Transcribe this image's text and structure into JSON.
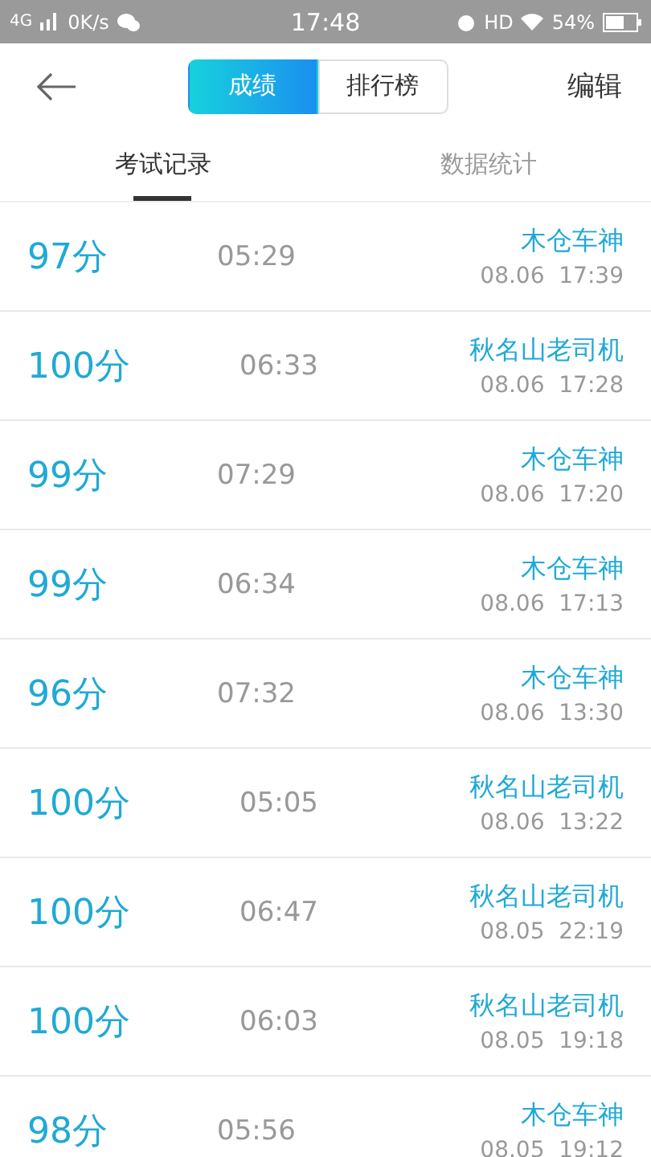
{
  "status_bar": {
    "network": "4G",
    "speed": "0K/s",
    "time": "17:48",
    "hd": "HD",
    "battery": "54%"
  },
  "header": {
    "segments": [
      {
        "label": "成绩",
        "selected": true
      },
      {
        "label": "排行榜",
        "selected": false
      }
    ],
    "action": "编辑"
  },
  "tabs": [
    {
      "label": "考试记录",
      "selected": true
    },
    {
      "label": "数据统计",
      "selected": false
    }
  ],
  "records": [
    {
      "score": "97分",
      "duration": "05:29",
      "name": "木仓车神",
      "date": "08.06  17:39"
    },
    {
      "score": "100分",
      "duration": "06:33",
      "name": "秋名山老司机",
      "date": "08.06  17:28"
    },
    {
      "score": "99分",
      "duration": "07:29",
      "name": "木仓车神",
      "date": "08.06  17:20"
    },
    {
      "score": "99分",
      "duration": "06:34",
      "name": "木仓车神",
      "date": "08.06  17:13"
    },
    {
      "score": "96分",
      "duration": "07:32",
      "name": "木仓车神",
      "date": "08.06  13:30"
    },
    {
      "score": "100分",
      "duration": "05:05",
      "name": "秋名山老司机",
      "date": "08.06  13:22"
    },
    {
      "score": "100分",
      "duration": "06:47",
      "name": "秋名山老司机",
      "date": "08.05  22:19"
    },
    {
      "score": "100分",
      "duration": "06:03",
      "name": "秋名山老司机",
      "date": "08.05  19:18"
    },
    {
      "score": "98分",
      "duration": "05:56",
      "name": "木仓车神",
      "date": "08.05  19:12"
    }
  ]
}
